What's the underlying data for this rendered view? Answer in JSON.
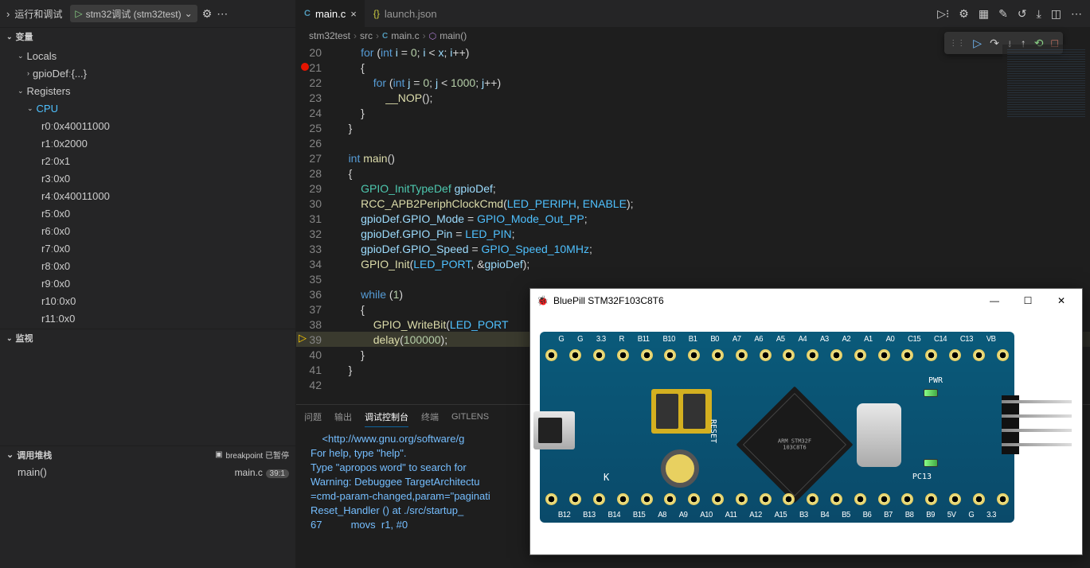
{
  "sidebar": {
    "title": "运行和调试",
    "launch_config": "stm32调试 (stm32test)",
    "variables_title": "变量",
    "locals_title": "Locals",
    "gpioDef_name": "gpioDef",
    "gpioDef_val": "{...}",
    "registers_title": "Registers",
    "cpu_label": "CPU",
    "registers": [
      {
        "name": "r0",
        "val": "0x40011000"
      },
      {
        "name": "r1",
        "val": "0x2000"
      },
      {
        "name": "r2",
        "val": "0x1"
      },
      {
        "name": "r3",
        "val": "0x0"
      },
      {
        "name": "r4",
        "val": "0x40011000"
      },
      {
        "name": "r5",
        "val": "0x0"
      },
      {
        "name": "r6",
        "val": "0x0"
      },
      {
        "name": "r7",
        "val": "0x0"
      },
      {
        "name": "r8",
        "val": "0x0"
      },
      {
        "name": "r9",
        "val": "0x0"
      },
      {
        "name": "r10",
        "val": "0x0"
      },
      {
        "name": "r11",
        "val": "0x0"
      }
    ],
    "watch_title": "监视",
    "callstack_title": "调用堆栈",
    "callstack_status": "breakpoint 已暂停",
    "callstack_fn": "main()",
    "callstack_file": "main.c",
    "callstack_pos": "39:1"
  },
  "tabs": {
    "t1_label": "main.c",
    "t2_label": "launch.json"
  },
  "breadcrumb": {
    "p1": "stm32test",
    "p2": "src",
    "p3": "main.c",
    "p4": "main()"
  },
  "code_lines": [
    {
      "n": 20,
      "html": "        <span class='kw'>for</span> <span class='pun'>(</span><span class='kw'>int</span> <span class='id'>i</span> <span class='op'>=</span> <span class='num'>0</span><span class='pun'>;</span> <span class='id'>i</span> <span class='op'>&lt;</span> <span class='id'>x</span><span class='pun'>;</span> <span class='id'>i</span><span class='op'>++</span><span class='pun'>)</span>"
    },
    {
      "n": 21,
      "bp": true,
      "html": "        <span class='pun'>{</span>"
    },
    {
      "n": 22,
      "html": "            <span class='kw'>for</span> <span class='pun'>(</span><span class='kw'>int</span> <span class='id'>j</span> <span class='op'>=</span> <span class='num'>0</span><span class='pun'>;</span> <span class='id'>j</span> <span class='op'>&lt;</span> <span class='num'>1000</span><span class='pun'>;</span> <span class='id'>j</span><span class='op'>++</span><span class='pun'>)</span>"
    },
    {
      "n": 23,
      "html": "                <span class='fn'>__NOP</span><span class='pun'>();</span>"
    },
    {
      "n": 24,
      "html": "        <span class='pun'>}</span>"
    },
    {
      "n": 25,
      "html": "    <span class='pun'>}</span>"
    },
    {
      "n": 26,
      "html": ""
    },
    {
      "n": 27,
      "html": "    <span class='kw'>int</span> <span class='fn'>main</span><span class='pun'>()</span>"
    },
    {
      "n": 28,
      "html": "    <span class='pun'>{</span>"
    },
    {
      "n": 29,
      "html": "        <span class='ty'>GPIO_InitTypeDef</span> <span class='id'>gpioDef</span><span class='pun'>;</span>"
    },
    {
      "n": 30,
      "html": "        <span class='fn'>RCC_APB2PeriphClockCmd</span><span class='pun'>(</span><span class='const'>LED_PERIPH</span><span class='pun'>,</span> <span class='const'>ENABLE</span><span class='pun'>);</span>"
    },
    {
      "n": 31,
      "html": "        <span class='id'>gpioDef</span><span class='pun'>.</span><span class='id'>GPIO_Mode</span> <span class='op'>=</span> <span class='const'>GPIO_Mode_Out_PP</span><span class='pun'>;</span>"
    },
    {
      "n": 32,
      "html": "        <span class='id'>gpioDef</span><span class='pun'>.</span><span class='id'>GPIO_Pin</span> <span class='op'>=</span> <span class='const'>LED_PIN</span><span class='pun'>;</span>"
    },
    {
      "n": 33,
      "html": "        <span class='id'>gpioDef</span><span class='pun'>.</span><span class='id'>GPIO_Speed</span> <span class='op'>=</span> <span class='const'>GPIO_Speed_10MHz</span><span class='pun'>;</span>"
    },
    {
      "n": 34,
      "html": "        <span class='fn'>GPIO_Init</span><span class='pun'>(</span><span class='const'>LED_PORT</span><span class='pun'>,</span> <span class='op'>&amp;</span><span class='id'>gpioDef</span><span class='pun'>);</span>"
    },
    {
      "n": 35,
      "html": ""
    },
    {
      "n": 36,
      "html": "        <span class='kw'>while</span> <span class='pun'>(</span><span class='num'>1</span><span class='pun'>)</span>"
    },
    {
      "n": 37,
      "html": "        <span class='pun'>{</span>"
    },
    {
      "n": 38,
      "html": "            <span class='fn'>GPIO_WriteBit</span><span class='pun'>(</span><span class='const'>LED_PORT</span>"
    },
    {
      "n": 39,
      "cp": true,
      "hl": true,
      "html": "            <span class='fn'>delay</span><span class='pun'>(</span><span class='num'>100000</span><span class='pun'>);</span>"
    },
    {
      "n": 40,
      "html": "        <span class='pun'>}</span>"
    },
    {
      "n": 41,
      "html": "    <span class='pun'>}</span>"
    },
    {
      "n": 42,
      "html": ""
    }
  ],
  "bottom_tabs": {
    "t1": "问题",
    "t2": "输出",
    "t3": "调试控制台",
    "t4": "终端",
    "t5": "GITLENS"
  },
  "console_lines": [
    "    <http://www.gnu.org/software/g",
    "",
    "For help, type \"help\".",
    "Type \"apropos word\" to search for ",
    "Warning: Debuggee TargetArchitectu",
    "=cmd-param-changed,param=\"paginati",
    "Reset_Handler () at ./src/startup_",
    "67          movs  r1, #0"
  ],
  "popup": {
    "title": "BluePill STM32F103C8T6",
    "top_pins": [
      "G",
      "G",
      "3.3",
      "R",
      "B11",
      "B10",
      "B1",
      "B0",
      "A7",
      "A6",
      "A5",
      "A4",
      "A3",
      "A2",
      "A1",
      "A0",
      "C15",
      "C14",
      "C13",
      "VB"
    ],
    "bot_pins": [
      "B12",
      "B13",
      "B14",
      "B15",
      "A8",
      "A9",
      "A10",
      "A11",
      "A12",
      "A15",
      "B3",
      "B4",
      "B5",
      "B6",
      "B7",
      "B8",
      "B9",
      "5V",
      "G",
      "3.3"
    ],
    "reset_label": "RESET",
    "k_label": "K",
    "pwr_label": "PWR",
    "pc13_label": "PC13",
    "chip_text": "ARM\nSTM32F\n103C8T6"
  }
}
